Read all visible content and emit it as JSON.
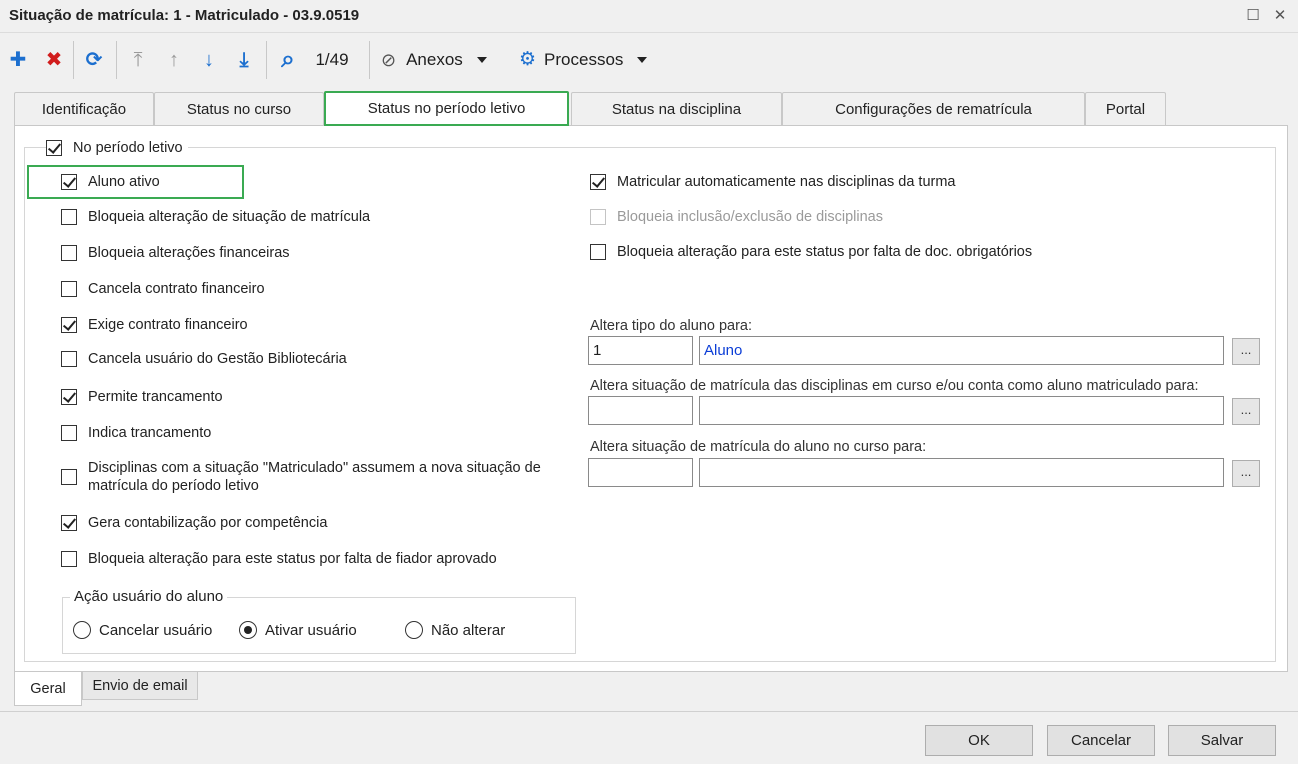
{
  "window": {
    "title": "Situação de matrícula: 1 - Matriculado - 03.9.0519",
    "maximize_glyph": "☐",
    "close_glyph": "✕"
  },
  "toolbar": {
    "add_glyph": "✚",
    "delete_glyph": "✖",
    "refresh_glyph": "⟳",
    "first_glyph": "⤒",
    "prev_glyph": "↑",
    "next_glyph": "↓",
    "last_glyph": "⤓",
    "search_glyph": "⌕",
    "record_counter": "1/49",
    "attach_glyph": "⊘",
    "attachments_label": "Anexos",
    "process_glyph": "⚙",
    "processes_label": "Processos"
  },
  "colors": {
    "add": "#1c6fcf",
    "delete": "#d11c1c",
    "nav": "#1c6fcf",
    "highlight": "#3aaa52",
    "link_blue": "#0b3dd6"
  },
  "tabs": [
    {
      "label": "Identificação"
    },
    {
      "label": "Status no curso"
    },
    {
      "label": "Status no período letivo"
    },
    {
      "label": "Status na disciplina"
    },
    {
      "label": "Configurações de rematrícula"
    },
    {
      "label": "Portal"
    }
  ],
  "period": {
    "group_label": "No período letivo",
    "left": [
      {
        "label": "Aluno ativo",
        "checked": true
      },
      {
        "label": "Bloqueia alteração de situação de matrícula",
        "checked": false
      },
      {
        "label": "Bloqueia alterações financeiras",
        "checked": false
      },
      {
        "label": "Cancela contrato financeiro",
        "checked": false
      },
      {
        "label": "Exige contrato financeiro",
        "checked": true
      },
      {
        "label": "Cancela usuário do Gestão Bibliotecária",
        "checked": false
      },
      {
        "label": "Permite trancamento",
        "checked": true
      },
      {
        "label": "Indica trancamento",
        "checked": false
      },
      {
        "label": "Disciplinas com a situação \"Matriculado\" assumem a nova situação de matrícula do período letivo",
        "checked": false
      },
      {
        "label": "Gera contabilização por competência",
        "checked": true
      },
      {
        "label": "Bloqueia alteração para este status por falta de fiador aprovado",
        "checked": false
      }
    ],
    "right": [
      {
        "label": "Matricular automaticamente nas disciplinas da turma",
        "checked": true
      },
      {
        "label": "Bloqueia inclusão/exclusão de disciplinas",
        "checked": false
      },
      {
        "label": "Bloqueia alteração para este status por falta de doc. obrigatórios",
        "checked": false
      }
    ],
    "fields": {
      "tipo_label": "Altera tipo do aluno para:",
      "tipo_code": "1",
      "tipo_desc": "Aluno",
      "disc_label": "Altera situação de matrícula das disciplinas em curso e/ou conta como aluno matriculado para:",
      "disc_code": "",
      "disc_desc": "",
      "curso_label": "Altera situação de matrícula do aluno no curso para:",
      "curso_code": "",
      "curso_desc": "",
      "lookup_label": "..."
    },
    "user_action": {
      "title": "Ação usuário do aluno",
      "options": [
        {
          "label": "Cancelar usuário",
          "selected": false
        },
        {
          "label": "Ativar usuário",
          "selected": true
        },
        {
          "label": "Não alterar",
          "selected": false
        }
      ]
    }
  },
  "bottom_tabs": [
    {
      "label": "Geral"
    },
    {
      "label": "Envio de email"
    }
  ],
  "footer": {
    "ok": "OK",
    "cancel": "Cancelar",
    "save": "Salvar"
  }
}
